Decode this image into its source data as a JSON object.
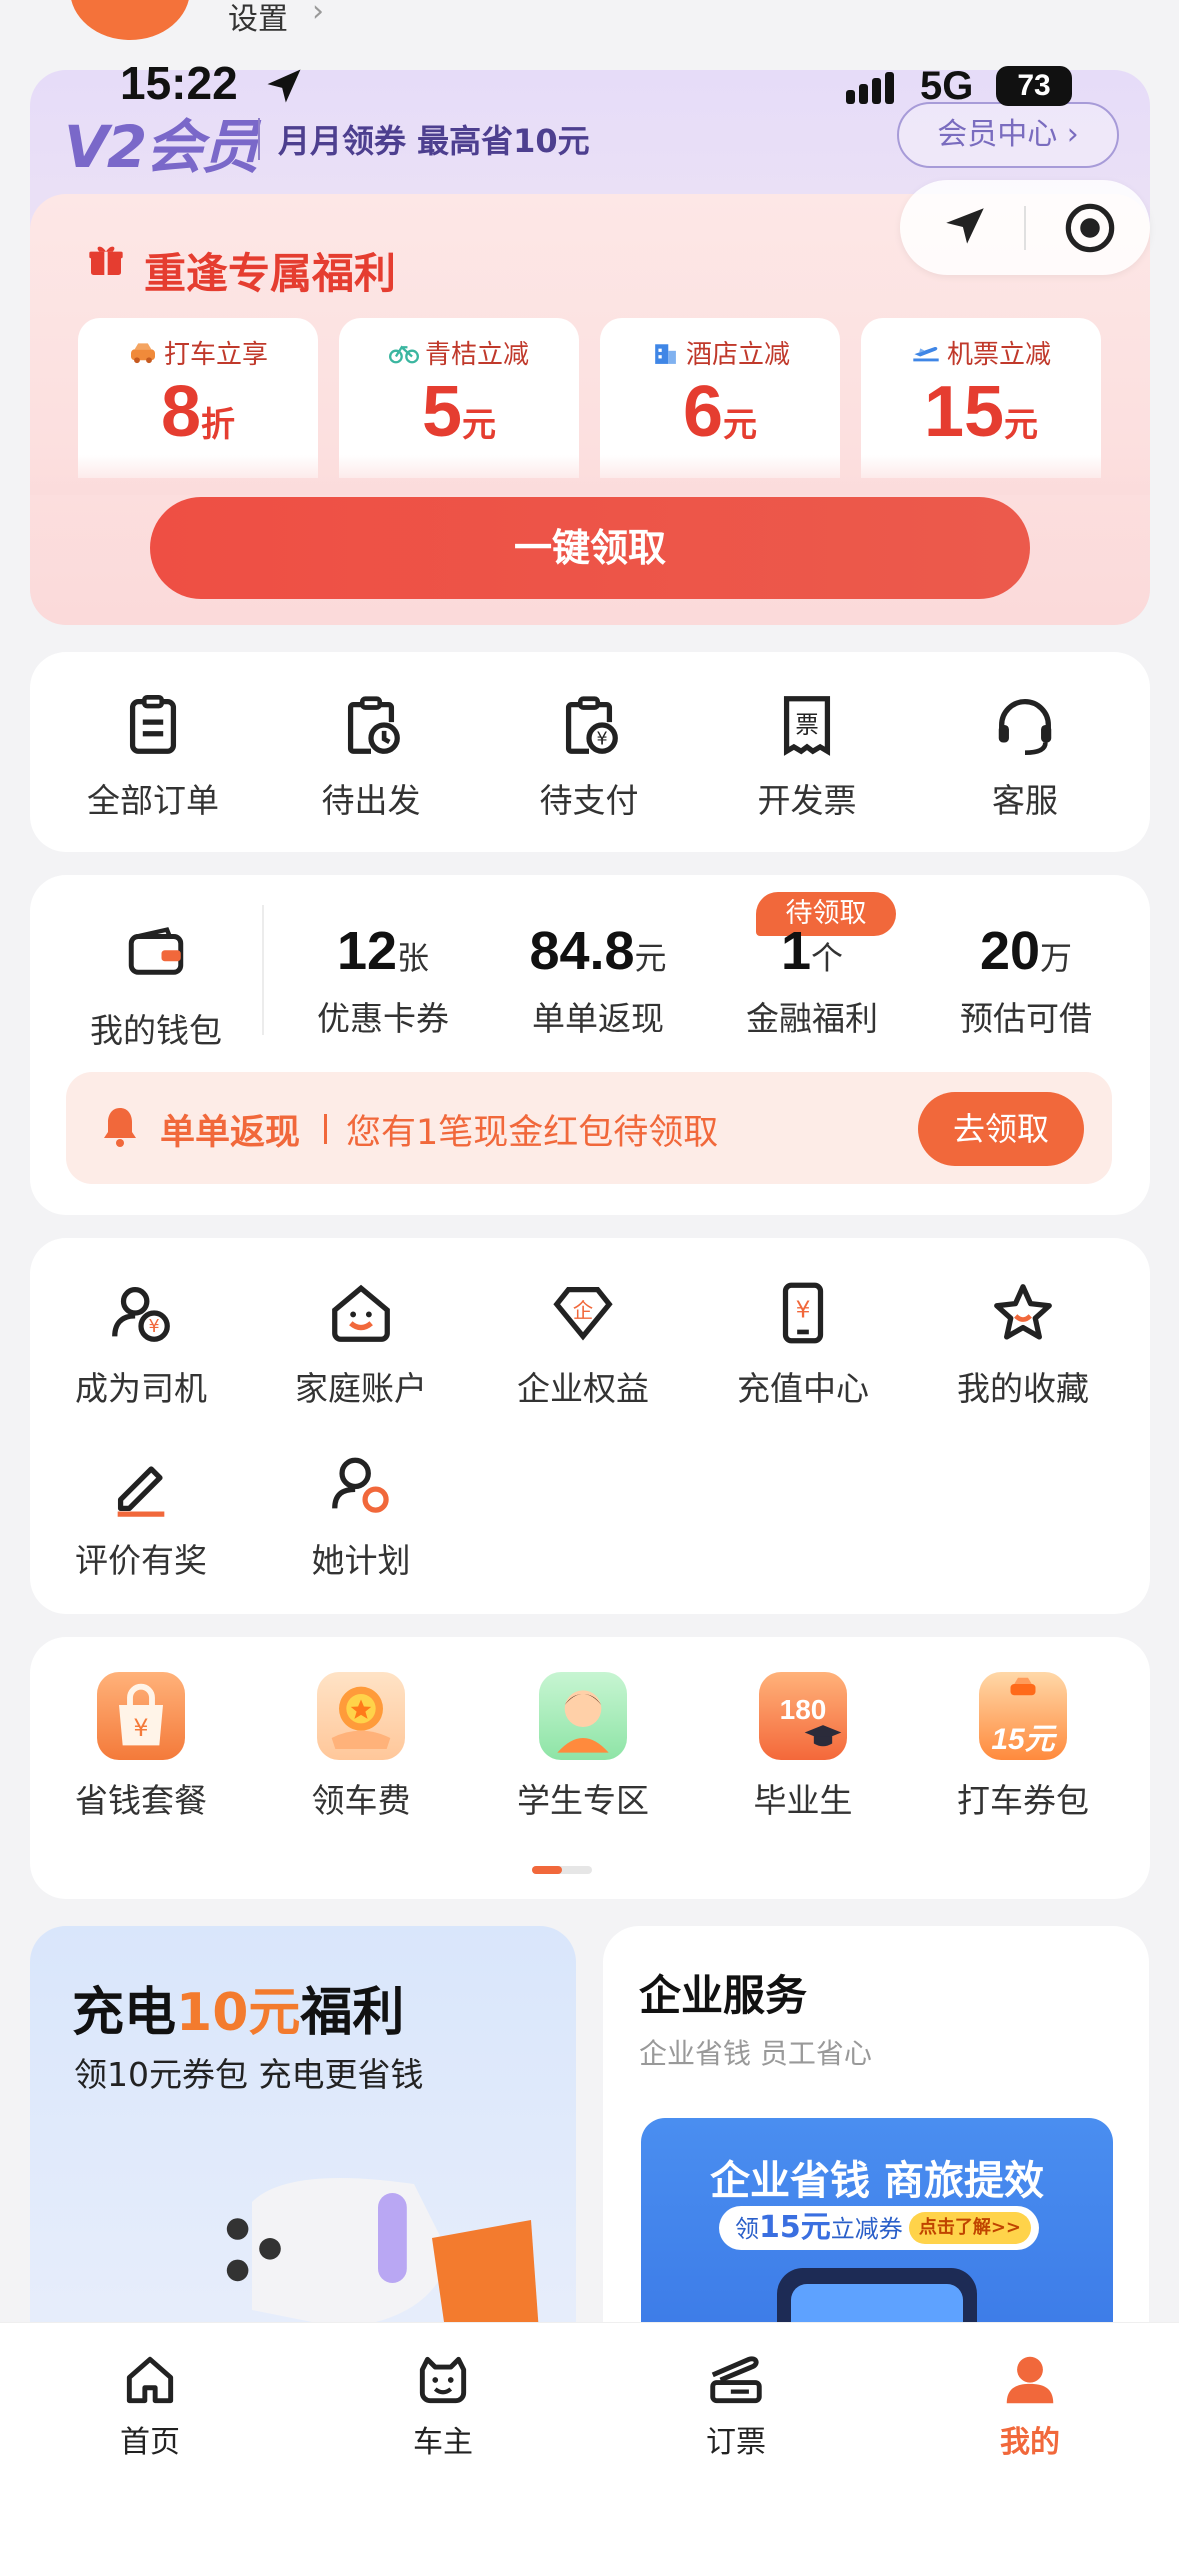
{
  "header_peek": {
    "settings_label": "设置"
  },
  "status_bar": {
    "time": "15:22",
    "network": "5G",
    "battery": "73"
  },
  "member": {
    "logo": "V2会员",
    "slogan": "月月领券  最高省10元",
    "center_button": "会员中心 ›",
    "benefit_title": "重逢专属福利",
    "deals": [
      {
        "label": "打车立享",
        "value": "8",
        "unit": "折",
        "icon": "car-icon"
      },
      {
        "label": "青桔立减",
        "value": "5",
        "unit": "元",
        "icon": "bike-icon"
      },
      {
        "label": "酒店立减",
        "value": "6",
        "unit": "元",
        "icon": "hotel-icon"
      },
      {
        "label": "机票立减",
        "value": "15",
        "unit": "元",
        "icon": "plane-icon"
      }
    ],
    "claim_button": "一键领取"
  },
  "orders": [
    {
      "label": "全部订单",
      "icon": "clipboard-icon"
    },
    {
      "label": "待出发",
      "icon": "clock-clipboard-icon"
    },
    {
      "label": "待支付",
      "icon": "yuan-clipboard-icon"
    },
    {
      "label": "开发票",
      "icon": "invoice-icon"
    },
    {
      "label": "客服",
      "icon": "headset-icon"
    }
  ],
  "wallet": {
    "label": "我的钱包",
    "items": [
      {
        "value": "12",
        "unit": "张",
        "label": "优惠卡券"
      },
      {
        "value": "84.8",
        "unit": "元",
        "label": "单单返现"
      },
      {
        "value": "1",
        "unit": "个",
        "label": "金融福利"
      },
      {
        "value": "20",
        "unit": "万",
        "label": "预估可借"
      }
    ],
    "badge": "待领取",
    "cashback": {
      "title": "单单返现",
      "text": "您有1笔现金红包待领取",
      "button": "去领取"
    }
  },
  "services": [
    {
      "label": "成为司机",
      "icon": "driver-icon"
    },
    {
      "label": "家庭账户",
      "icon": "home-smile-icon"
    },
    {
      "label": "企业权益",
      "icon": "enterprise-icon"
    },
    {
      "label": "充值中心",
      "icon": "recharge-icon"
    },
    {
      "label": "我的收藏",
      "icon": "star-icon"
    },
    {
      "label": "评价有奖",
      "icon": "pen-icon"
    },
    {
      "label": "她计划",
      "icon": "her-plan-icon"
    }
  ],
  "promos": [
    {
      "label": "省钱套餐",
      "icon": "savings-bag-icon"
    },
    {
      "label": "领车费",
      "icon": "coin-hand-icon"
    },
    {
      "label": "学生专区",
      "icon": "student-icon"
    },
    {
      "label": "毕业生",
      "icon": "graduate-icon",
      "text": "180"
    },
    {
      "label": "打车券包",
      "icon": "taxi-coupon-icon",
      "text": "15元"
    }
  ],
  "charge_card": {
    "title_a": "充电",
    "title_b": "10元",
    "title_c": "福利",
    "subtitle": "领10元券包 充电更省钱"
  },
  "biz_card": {
    "title": "企业服务",
    "subtitle": "企业省钱 员工省心",
    "banner_title": "企业省钱 商旅提效",
    "pill_a": "领",
    "pill_n": "15元",
    "pill_b": "立减券",
    "pill_more": "点击了解>>"
  },
  "tabbar": [
    {
      "label": "首页",
      "icon": "home-icon"
    },
    {
      "label": "车主",
      "icon": "car-owner-icon"
    },
    {
      "label": "订票",
      "icon": "ticket-icon"
    },
    {
      "label": "我的",
      "icon": "profile-icon",
      "active": true
    }
  ],
  "colors": {
    "accent": "#f1683b",
    "red": "#e53d30",
    "purple": "#7a68c9"
  }
}
